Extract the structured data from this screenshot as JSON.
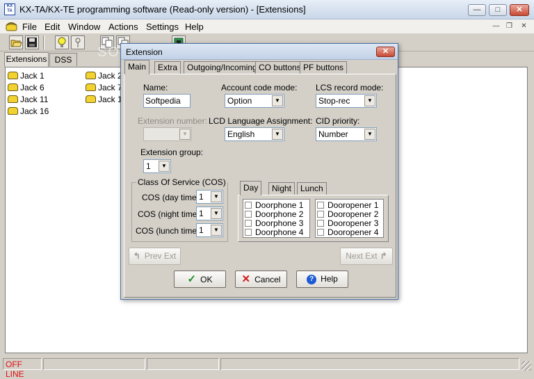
{
  "window": {
    "title": "KX-TA/KX-TE programming software (Read-only version) - [Extensions]",
    "app_icon_text": "KX TA",
    "controls": {
      "minimize": "—",
      "maximize": "□",
      "close": "✕"
    }
  },
  "menu": {
    "items": [
      "File",
      "Edit",
      "Window",
      "Actions",
      "Settings",
      "Help"
    ],
    "mdi_controls": {
      "minimize": "—",
      "restore": "❐",
      "close": "✕"
    }
  },
  "toolbar": {
    "buttons": [
      "open-icon",
      "save-icon",
      "bulb-icon",
      "pin-icon",
      "copy-icon",
      "copy2-icon",
      "pcb-icon"
    ]
  },
  "main_tabs": [
    "Extensions",
    "DSS"
  ],
  "extensions": {
    "col1": [
      "Jack 1",
      "Jack 6",
      "Jack 11",
      "Jack 16"
    ],
    "col2": [
      "Jack 2",
      "Jack 7",
      "Jack 1"
    ]
  },
  "watermark": "SOFTPEDIA",
  "dialog": {
    "title": "Extension",
    "close": "✕",
    "tabs": [
      "Main",
      "Extra",
      "Outgoing/Incoming",
      "CO buttons",
      "PF buttons"
    ],
    "name": {
      "label": "Name:",
      "value": "Softpedia"
    },
    "account_code_mode": {
      "label": "Account code mode:",
      "value": "Option"
    },
    "lcs_record_mode": {
      "label": "LCS record mode:",
      "value": "Stop-rec"
    },
    "extension_number": {
      "label": "Extension number:",
      "value": ""
    },
    "lcd_language": {
      "label": "LCD Language Assignment:",
      "value": "English"
    },
    "cid_priority": {
      "label": "CID priority:",
      "value": "Number"
    },
    "extension_group": {
      "label": "Extension group:",
      "value": "1"
    },
    "cos": {
      "legend": "Class Of Service (COS)",
      "day": {
        "label": "COS (day time):",
        "value": "1"
      },
      "night": {
        "label": "COS (night time):",
        "value": "1"
      },
      "lunch": {
        "label": "COS (lunch time):",
        "value": "1"
      }
    },
    "period_tabs": [
      "Day",
      "Night",
      "Lunch"
    ],
    "doorphones": [
      "Doorphone 1",
      "Doorphone 2",
      "Doorphone 3",
      "Doorphone 4"
    ],
    "dooropeners": [
      "Dooropener 1",
      "Dooropener 2",
      "Dooropener 3",
      "Dooropener 4"
    ],
    "prev_ext": "Prev Ext",
    "next_ext": "Next Ext",
    "ok": "OK",
    "cancel": "Cancel",
    "help": "Help"
  },
  "status": {
    "mode": "OFF LINE"
  },
  "colors": {
    "status_offline": "#e01010",
    "accent": "#1a3e9c"
  }
}
